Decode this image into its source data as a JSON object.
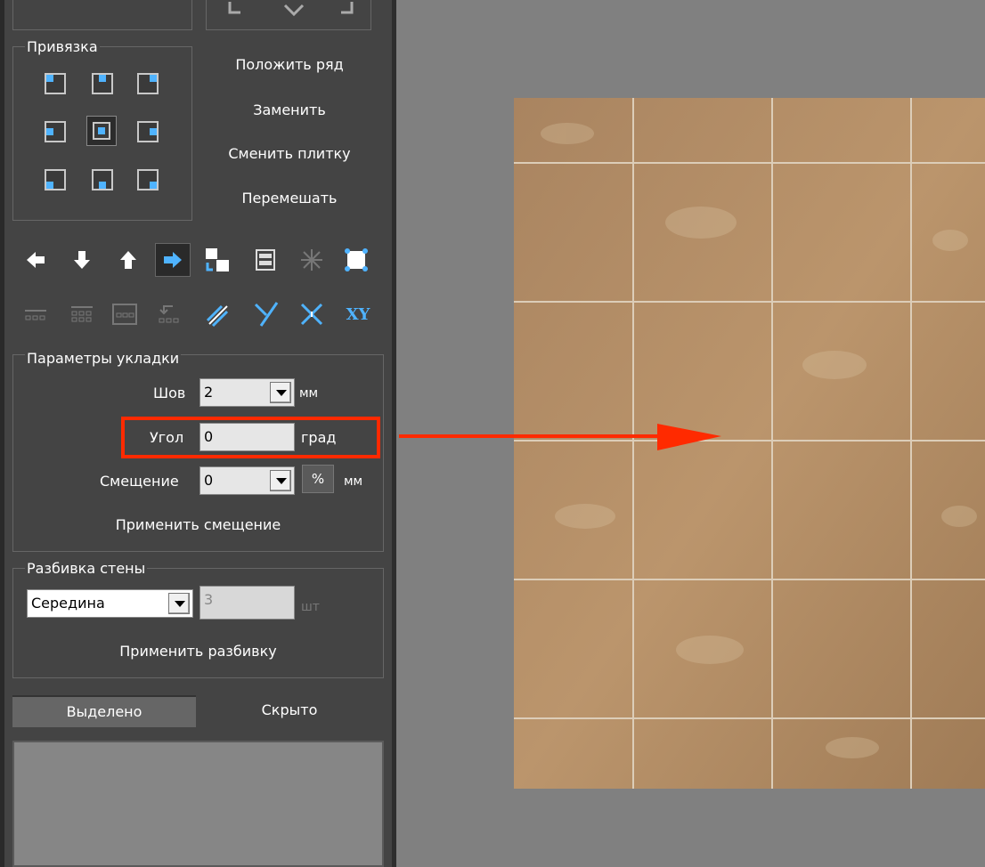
{
  "colors": {
    "panel": "#444444",
    "canvas": "#808080",
    "accent_blue": "#4fb3ff",
    "highlight_red": "#ff2a00",
    "tile": "#b08a62",
    "grout": "#d9cbb8"
  },
  "snap": {
    "title": "Привязка",
    "grid": [
      [
        "top-left",
        "top-center",
        "top-right"
      ],
      [
        "middle-left",
        "center",
        "middle-right"
      ],
      [
        "bottom-left",
        "bottom-center",
        "bottom-right"
      ]
    ],
    "active": "center"
  },
  "commands": {
    "lay_row": "Положить ряд",
    "replace": "Заменить",
    "change_tile": "Сменить плитку",
    "shuffle": "Перемешать"
  },
  "toolbar": {
    "row1": [
      "arrow-left-icon",
      "arrow-down-icon",
      "arrow-up-icon",
      "arrow-right-icon",
      "swap-tiles-icon",
      "stack-tiles-icon",
      "snowflake-icon",
      "puzzle-tile-icon"
    ],
    "row1_active": "arrow-right-icon",
    "row2": [
      "row-layout-icon",
      "grid-layout-icon",
      "frame-layout-icon",
      "undo-layout-icon",
      "diagonal-lines-icon",
      "y-split-icon",
      "cross-icon",
      "xy-icon"
    ],
    "xy_label": "XY"
  },
  "layout_params": {
    "title": "Параметры укладки",
    "seam_label": "Шов",
    "seam_value": "2",
    "seam_unit": "мм",
    "angle_label": "Угол",
    "angle_value": "0",
    "angle_unit": "град",
    "offset_label": "Смещение",
    "offset_value": "0",
    "offset_percent": "%",
    "offset_unit": "мм",
    "apply_offset": "Применить смещение"
  },
  "wall_split": {
    "title": "Разбивка стены",
    "mode_value": "Середина",
    "count_value": "3",
    "count_unit": "шт",
    "apply_split": "Применить разбивку"
  },
  "tabs": {
    "selected": "Выделено",
    "hidden": "Скрыто"
  }
}
